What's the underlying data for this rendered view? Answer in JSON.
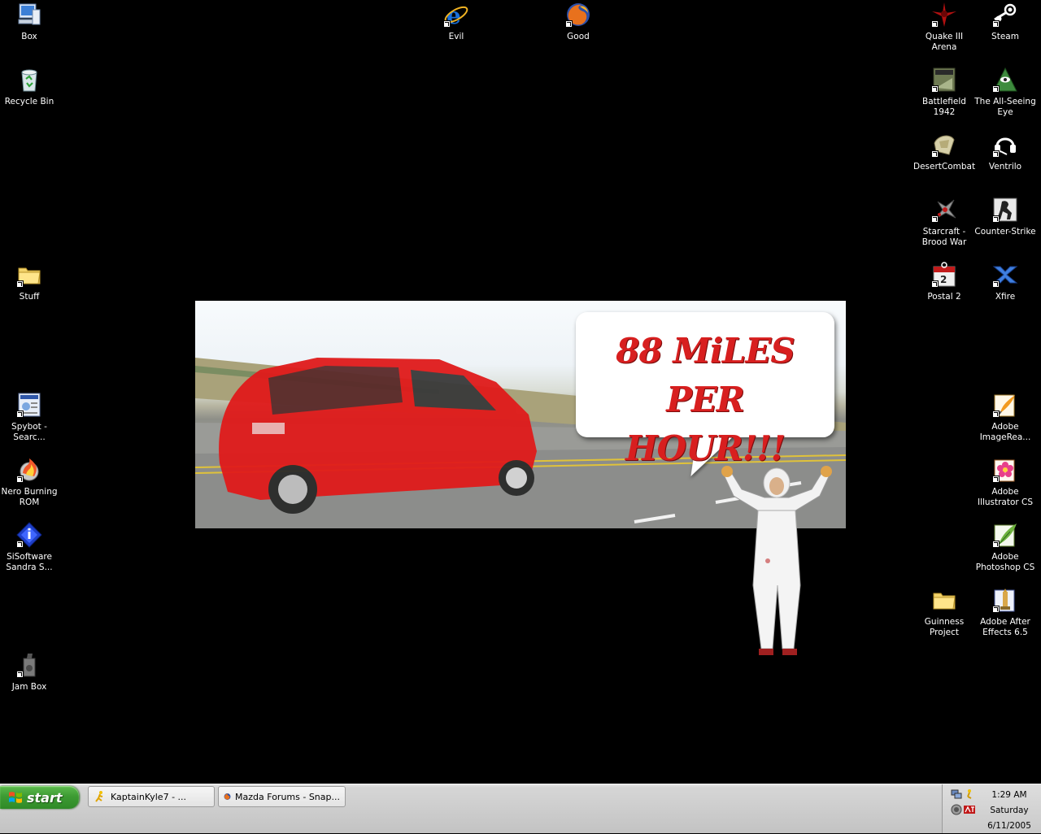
{
  "desktop": {
    "icons": {
      "box": "Box",
      "recycle_bin": "Recycle Bin",
      "stuff": "Stuff",
      "spybot": "Spybot - Searc...",
      "nero": "Nero Burning ROM",
      "sisoftware": "SiSoftware Sandra S...",
      "jam_box": "Jam Box",
      "evil": "Evil",
      "good": "Good",
      "quake": "Quake III Arena",
      "steam": "Steam",
      "battlefield": "Battlefield 1942",
      "all_seeing_eye": "The All-Seeing Eye",
      "desertcombat": "DesertCombat",
      "ventrilo": "Ventrilo",
      "starcraft": "Starcraft - Brood War",
      "counter_strike": "Counter-Strike",
      "postal": "Postal 2",
      "xfire": "Xfire",
      "imageready": "Adobe ImageRea...",
      "illustrator": "Adobe Illustrator CS",
      "photoshop": "Adobe Photoshop CS",
      "guinness": "Guinness Project",
      "after_effects": "Adobe After Effects 6.5"
    },
    "wallpaper": {
      "speech_line1": "88 MiLES PER",
      "speech_line2": "HOUR!!!"
    }
  },
  "taskbar": {
    "start_label": "start",
    "tasks": [
      {
        "label": "KaptainKyle7 - ..."
      },
      {
        "label": "Mazda Forums - Snap..."
      }
    ],
    "clock": {
      "time": "1:29 AM",
      "day": "Saturday",
      "date": "6/11/2005"
    }
  },
  "colors": {
    "desktop_bg": "#000000",
    "start_green": "#3d9b33",
    "speech_text": "#d81f1f",
    "car_red": "#e01b1b"
  }
}
